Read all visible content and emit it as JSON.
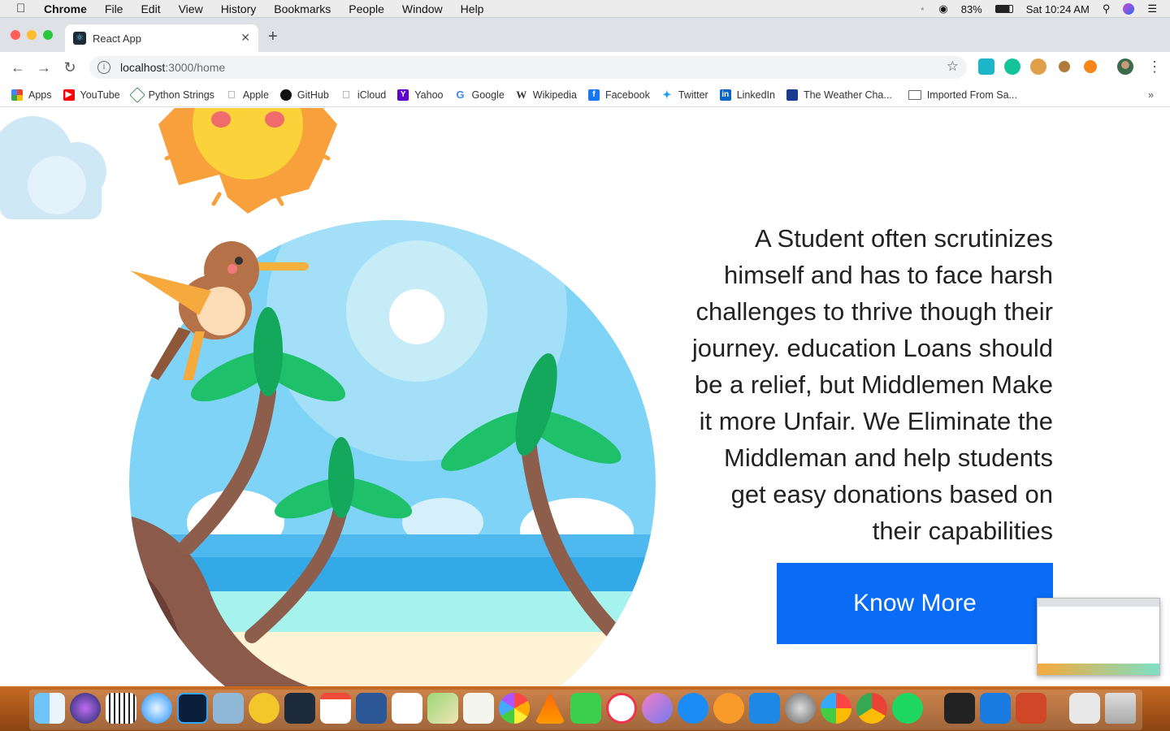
{
  "menubar": {
    "app": "Chrome",
    "items": [
      "File",
      "Edit",
      "View",
      "History",
      "Bookmarks",
      "People",
      "Window",
      "Help"
    ],
    "battery": "83%",
    "clock": "Sat 10:24 AM"
  },
  "tab": {
    "title": "React App"
  },
  "address": {
    "host": "localhost",
    "path": ":3000/home"
  },
  "bookmarks": [
    {
      "label": "Apps",
      "icon": "apps-grid-icon",
      "color": "#e8453c"
    },
    {
      "label": "YouTube",
      "icon": "youtube-icon",
      "color": "#ff0000"
    },
    {
      "label": "Python Strings",
      "icon": "python-strings-icon",
      "color": "#4a8c5f"
    },
    {
      "label": "Apple",
      "icon": "apple-icon",
      "color": "#777777"
    },
    {
      "label": "GitHub",
      "icon": "github-icon",
      "color": "#111111"
    },
    {
      "label": "iCloud",
      "icon": "icloud-icon",
      "color": "#777777"
    },
    {
      "label": "Yahoo",
      "icon": "yahoo-icon",
      "color": "#5f01d1"
    },
    {
      "label": "Google",
      "icon": "google-icon",
      "color": "#4285f4"
    },
    {
      "label": "Wikipedia",
      "icon": "wikipedia-icon",
      "color": "#333333"
    },
    {
      "label": "Facebook",
      "icon": "facebook-icon",
      "color": "#1877f2"
    },
    {
      "label": "Twitter",
      "icon": "twitter-icon",
      "color": "#1da1f2"
    },
    {
      "label": "LinkedIn",
      "icon": "linkedin-icon",
      "color": "#0a66c2"
    },
    {
      "label": "The Weather Cha...",
      "icon": "weather-channel-icon",
      "color": "#1a3a8f"
    },
    {
      "label": "Imported From Sa...",
      "icon": "folder-icon",
      "color": "#666666"
    }
  ],
  "hero": {
    "text": "A Student often scrutinizes himself and has to face harsh challenges to thrive though their journey. education Loans should be a relief, but Middlemen Make it more Unfair. We Eliminate the Middleman and help students get easy donations based on their capabilities",
    "button": "Know More",
    "button_color": "#0a6cf5"
  }
}
